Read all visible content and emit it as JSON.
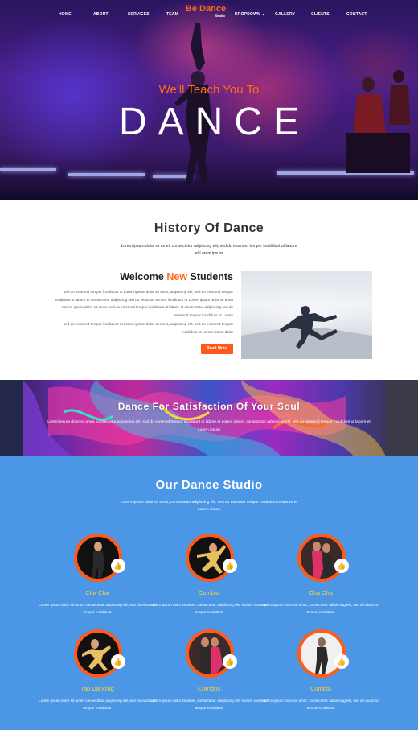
{
  "nav": {
    "items_left": [
      "HOME",
      "ABOUT",
      "SERVICES",
      "TEAM"
    ],
    "brand": "Be Dance",
    "brand_sub": "Studio",
    "items_right": [
      "DROPDOWN",
      "GALLERY",
      "CLIENTS",
      "CONTACT"
    ]
  },
  "hero": {
    "subtitle": "We'll Teach You To",
    "title": "DANCE"
  },
  "history": {
    "title": "History Of Dance",
    "text": "Lorem ipsum dolor sit amet, consectetur adipiscing elit, sed do eiusmod tempor incididunt ut labore et Lorem ipsum"
  },
  "welcome": {
    "title_pre": "Welcome ",
    "title_highlight": "New",
    "title_post": " Students",
    "para1": "sed do eiusmod tempor incididunt ut Lorem ipsum dolor sit amet, adipiscing elit, sed do eiusmod tempor incididunt ut labore et consectetur adipiscing sed do eiusmod tempor incididunt ut Lorem ipsum dolor sit amet Lorem ipsum dolor sit amet, sed do eiusmod tempor incididunt ut labore et consectetur adipiscing sed do eiusmod tempor incididunt ut Lorem",
    "para2": "sed do eiusmod tempor incididunt ut Lorem ipsum dolor sit amet, adipiscing elit, sed do eiusmod tempor incididunt ut Lorem ipsum dolor",
    "button": "Read More"
  },
  "banner": {
    "title": "Dance For Satisfaction Of Your Soul",
    "text": "Lorem ipsum dolor sit amet, consectetur adipiscing elit, sed do eiusmod tempor incididunt ut labore et Lorem ipsum, consectetur adipiscing elit, sed do eiusmod tempor incididunt ut labore et Lorem ipsum"
  },
  "studio": {
    "title": "Our Dance Studio",
    "text": "Lorem ipsum dolor sit amet, consectetur adipiscing elit, sed do eiusmod tempor incididunt ut labore et Lorem ipsum",
    "cards": [
      {
        "name": "Cha Cha",
        "text": "Lorem ipsum dolor sit amet, consectetur adipiscing elit, sed do eiusmod tempor incididunt"
      },
      {
        "name": "Cumbia",
        "text": "Lorem ipsum dolor sit amet, consectetur adipiscing elit, sed do eiusmod tempor incididunt"
      },
      {
        "name": "Cha Cha",
        "text": "Lorem ipsum dolor sit amet, consectetur adipiscing elit, sed do eiusmod tempor incididunt"
      },
      {
        "name": "Tap Dancing",
        "text": "Lorem ipsum dolor sit amet, consectetur adipiscing elit, sed do eiusmod tempor incididunt"
      },
      {
        "name": "Corridos",
        "text": "Lorem ipsum dolor sit amet, consectetur adipiscing elit, sed do eiusmod tempor incididunt"
      },
      {
        "name": "Cumbia",
        "text": "Lorem ipsum dolor sit amet, consectetur adipiscing elit, sed do eiusmod tempor incididunt"
      }
    ],
    "like_icon": "thumbs-up-icon"
  },
  "colors": {
    "accent": "#ff5a1a",
    "highlight_yellow": "#ffd23a",
    "studio_bg": "#4b97e5"
  }
}
